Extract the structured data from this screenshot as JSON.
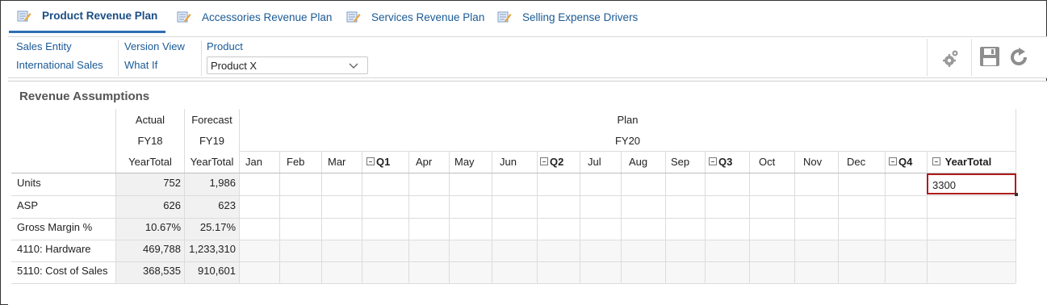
{
  "tabs": [
    {
      "label": "Product Revenue Plan",
      "active": true
    },
    {
      "label": "Accessories Revenue Plan",
      "active": false
    },
    {
      "label": "Services Revenue Plan",
      "active": false
    },
    {
      "label": "Selling Expense Drivers",
      "active": false
    }
  ],
  "pov": {
    "entity_label": "Sales Entity",
    "entity_value": "International Sales",
    "version_label": "Version View",
    "version_value": "What If",
    "product_label": "Product",
    "product_value": "Product X"
  },
  "toolbar": {
    "settings_icon": "gear-icon",
    "save_icon": "save-icon",
    "refresh_icon": "refresh-icon"
  },
  "grid": {
    "title": "Revenue Assumptions",
    "scenario_headers": [
      "Actual",
      "Forecast",
      "Plan"
    ],
    "year_headers": [
      "FY18",
      "FY19",
      "FY20"
    ],
    "period_headers": [
      "YearTotal",
      "YearTotal",
      "Jan",
      "Feb",
      "Mar",
      "Q1",
      "Apr",
      "May",
      "Jun",
      "Q2",
      "Jul",
      "Aug",
      "Sep",
      "Q3",
      "Oct",
      "Nov",
      "Dec",
      "Q4",
      "YearTotal"
    ],
    "rows": [
      {
        "label": "Units",
        "actual": "752",
        "forecast": "1,986"
      },
      {
        "label": "ASP",
        "actual": "626",
        "forecast": "623"
      },
      {
        "label": "Gross Margin %",
        "actual": "10.67%",
        "forecast": "25.17%"
      },
      {
        "label": "4110: Hardware",
        "actual": "469,788",
        "forecast": "1,233,310"
      },
      {
        "label": "5110: Cost of Sales",
        "actual": "368,535",
        "forecast": "910,601"
      }
    ],
    "edit_value": "3300"
  },
  "colors": {
    "link": "#1a5a96",
    "active_tab_underline": "#2e6eb5",
    "edit_border": "#b01c1c"
  }
}
